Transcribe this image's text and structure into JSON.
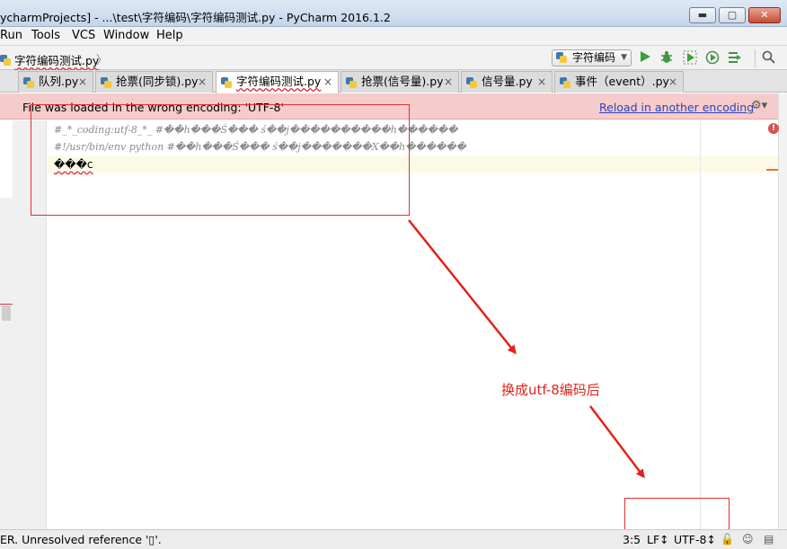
{
  "window": {
    "title": "ycharmProjects] - ...\\test\\字符编码\\字符编码测试.py - PyCharm 2016.1.2",
    "minimize_glyph": "▬",
    "maximize_glyph": "▢",
    "close_glyph": "✕"
  },
  "menu": [
    "Run",
    "Tools",
    "VCS",
    "Window",
    "Help"
  ],
  "breadcrumb": {
    "file": "字符编码测试.py",
    "arrow": "〉"
  },
  "toolbar": {
    "run_config": "字符编码",
    "caret": "▼",
    "icons": [
      "run-icon",
      "debug-icon",
      "coverage-icon",
      "profile-icon",
      "run-tests-icon",
      "search-icon"
    ]
  },
  "tabs": [
    {
      "label": "队列.py",
      "close": "×",
      "active": false
    },
    {
      "label": "抢票(同步锁).py",
      "close": "×",
      "active": false
    },
    {
      "label": "字符编码测试.py",
      "close": "×",
      "active": true
    },
    {
      "label": "抢票(信号量).py",
      "close": "×",
      "active": false
    },
    {
      "label": "信号量.py",
      "close": "×",
      "active": false
    },
    {
      "label": "事件（event）.py",
      "close": "×",
      "active": false
    }
  ],
  "banner": {
    "message": "File was loaded in the wrong encoding: 'UTF-8'",
    "link": "Reload in another encoding",
    "gear": "⚙▾",
    "bg_color": "#f6cbcb"
  },
  "editor": {
    "lines": [
      "#_*_coding:utf-8_*_ #��h���Ś��� ś��j����������h������",
      "#!/usr/bin/env python #��h���Ś��� ś��j�������X��h������",
      "���c"
    ],
    "error_marker": "!"
  },
  "annotation": {
    "text": "换成utf-8编码后",
    "color": "#e2231a"
  },
  "status": {
    "message": "ER. Unresolved reference '▯'.",
    "position": "3:5",
    "line_sep": "LF↕",
    "encoding": "UTF-8↕",
    "lock_glyph": "🔓",
    "inspector_glyph": "☺",
    "event_glyph": "▤"
  }
}
